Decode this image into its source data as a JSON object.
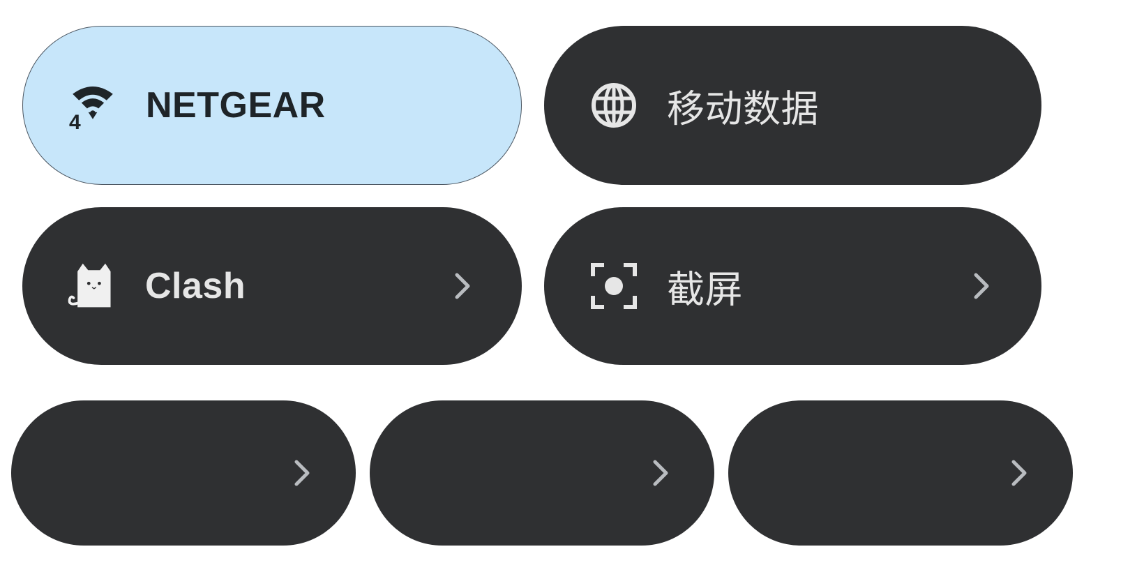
{
  "tiles": {
    "wifi": {
      "label": "NETGEAR",
      "icon": "wifi-4-icon",
      "badge": "4",
      "state": "on"
    },
    "mobile_data": {
      "label": "移动数据",
      "icon": "globe-icon",
      "state": "off"
    },
    "clash": {
      "label": "Clash",
      "icon": "cat-icon",
      "state": "off",
      "has_detail": true
    },
    "screenshot": {
      "label": "截屏",
      "icon": "screenshot-icon",
      "state": "off",
      "has_detail": true
    },
    "bottom_tiles": [
      {
        "label": "",
        "state": "off",
        "has_detail": true
      },
      {
        "label": "",
        "state": "off",
        "has_detail": true
      },
      {
        "label": "",
        "state": "off",
        "has_detail": true
      }
    ]
  },
  "colors": {
    "active_tile": "#c7e6fa",
    "inactive_tile": "#2f3032",
    "active_text": "#1e2428",
    "inactive_text": "#e6e6e6",
    "chevron": "#b9bcc0"
  }
}
